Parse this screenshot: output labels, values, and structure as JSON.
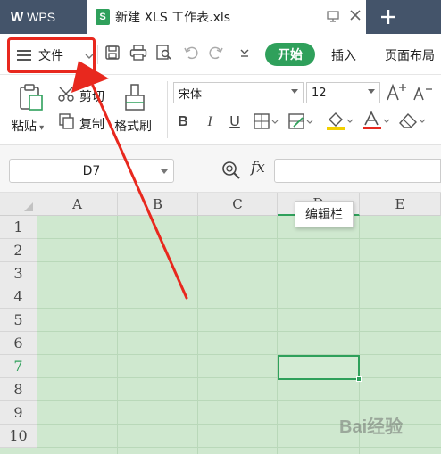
{
  "titlebar": {
    "app_name": "WPS",
    "doc_tab_title": "新建 XLS 工作表.xls",
    "doc_tab_badge": "S"
  },
  "menubar": {
    "file_label": "文件",
    "start_tab": "开始",
    "insert_tab": "插入",
    "page_layout_tab": "页面布局"
  },
  "ribbon": {
    "paste_label": "粘贴",
    "cut_label": "剪切",
    "copy_label": "复制",
    "format_painter_label": "格式刷",
    "font_name": "宋体",
    "font_size": "12"
  },
  "formula_bar": {
    "name_box": "D7",
    "fx_label": "fx"
  },
  "sheet": {
    "columns": [
      "A",
      "B",
      "C",
      "D",
      "E"
    ],
    "rows": [
      "1",
      "2",
      "3",
      "4",
      "5",
      "6",
      "7",
      "8",
      "9",
      "10"
    ],
    "active_cell": "D7"
  },
  "tooltip": {
    "text": "编辑栏"
  },
  "colors": {
    "accent": "#2fa05b",
    "title_bar": "#44546a",
    "annotation_red": "#e8281e",
    "grid_fill": "#cfe8cf"
  }
}
